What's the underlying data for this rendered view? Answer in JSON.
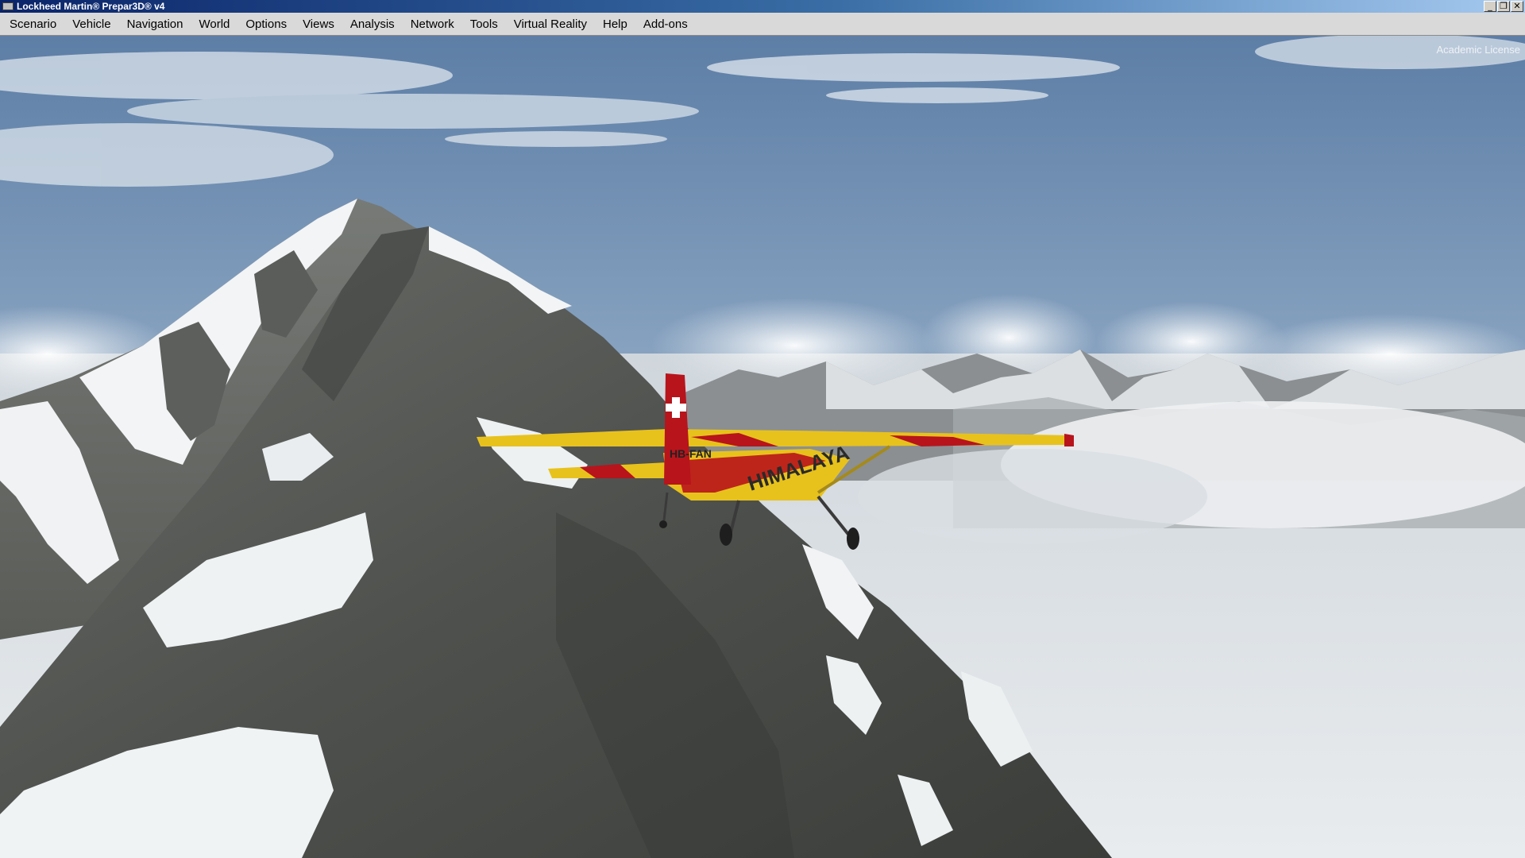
{
  "window": {
    "title": "Lockheed Martin® Prepar3D® v4",
    "controls": {
      "minimize": "_",
      "restore": "❐",
      "close": "✕"
    }
  },
  "menu": {
    "items": [
      {
        "id": "scenario",
        "label": "Scenario"
      },
      {
        "id": "vehicle",
        "label": "Vehicle"
      },
      {
        "id": "navigation",
        "label": "Navigation"
      },
      {
        "id": "world",
        "label": "World"
      },
      {
        "id": "options",
        "label": "Options"
      },
      {
        "id": "views",
        "label": "Views"
      },
      {
        "id": "analysis",
        "label": "Analysis"
      },
      {
        "id": "network",
        "label": "Network"
      },
      {
        "id": "tools",
        "label": "Tools"
      },
      {
        "id": "virtual-reality",
        "label": "Virtual Reality"
      },
      {
        "id": "help",
        "label": "Help"
      },
      {
        "id": "add-ons",
        "label": "Add-ons"
      }
    ]
  },
  "viewport": {
    "license_text": "Academic License",
    "aircraft": {
      "registration": "HB-FAN",
      "fuselage_text": "HIMALAYA",
      "tail_symbol": "swiss-cross"
    },
    "colors": {
      "sky_top": "#5d7ea6",
      "sky_horizon": "#b9c9d8",
      "rock": "#4f514e",
      "snow": "#f2f4f5",
      "aircraft_yellow": "#e8c21c",
      "aircraft_red": "#b8141c"
    }
  }
}
